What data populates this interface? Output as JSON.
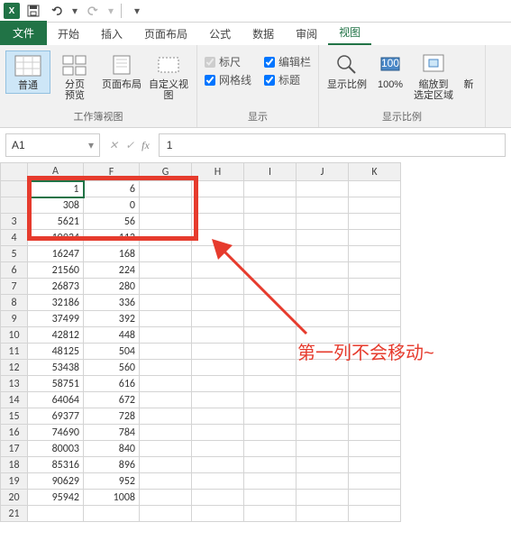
{
  "qat": {
    "excel": "X⊞"
  },
  "tabs": {
    "file": "文件",
    "home": "开始",
    "insert": "插入",
    "layout": "页面布局",
    "formula": "公式",
    "data": "数据",
    "review": "审阅",
    "view": "视图"
  },
  "ribbon": {
    "workbook_views": {
      "label": "工作簿视图",
      "normal": "普通",
      "page_break": "分页\n预览",
      "page_layout": "页面布局",
      "custom": "自定义视图"
    },
    "show": {
      "label": "显示",
      "ruler": "标尺",
      "formula_bar": "编辑栏",
      "gridlines": "网格线",
      "headings": "标题"
    },
    "zoom": {
      "label": "显示比例",
      "zoom": "显示比例",
      "hundred": "100%",
      "to_selection": "缩放到\n选定区域",
      "new": "新"
    }
  },
  "namebox": "A1",
  "fx_value": "1",
  "columns": [
    "A",
    "F",
    "G",
    "H",
    "I",
    "J",
    "K"
  ],
  "rows": [
    {
      "r": "",
      "a": "1",
      "f": "6"
    },
    {
      "r": "",
      "a": "308",
      "f": "0"
    },
    {
      "r": "3",
      "a": "5621",
      "f": "56"
    },
    {
      "r": "4",
      "a": "10934",
      "f": "112"
    },
    {
      "r": "5",
      "a": "16247",
      "f": "168"
    },
    {
      "r": "6",
      "a": "21560",
      "f": "224"
    },
    {
      "r": "7",
      "a": "26873",
      "f": "280"
    },
    {
      "r": "8",
      "a": "32186",
      "f": "336"
    },
    {
      "r": "9",
      "a": "37499",
      "f": "392"
    },
    {
      "r": "10",
      "a": "42812",
      "f": "448"
    },
    {
      "r": "11",
      "a": "48125",
      "f": "504"
    },
    {
      "r": "12",
      "a": "53438",
      "f": "560"
    },
    {
      "r": "13",
      "a": "58751",
      "f": "616"
    },
    {
      "r": "14",
      "a": "64064",
      "f": "672"
    },
    {
      "r": "15",
      "a": "69377",
      "f": "728"
    },
    {
      "r": "16",
      "a": "74690",
      "f": "784"
    },
    {
      "r": "17",
      "a": "80003",
      "f": "840"
    },
    {
      "r": "18",
      "a": "85316",
      "f": "896"
    },
    {
      "r": "19",
      "a": "90629",
      "f": "952"
    },
    {
      "r": "20",
      "a": "95942",
      "f": "1008"
    },
    {
      "r": "21",
      "a": "",
      "f": ""
    }
  ],
  "annotation": "第一列不会移动~"
}
